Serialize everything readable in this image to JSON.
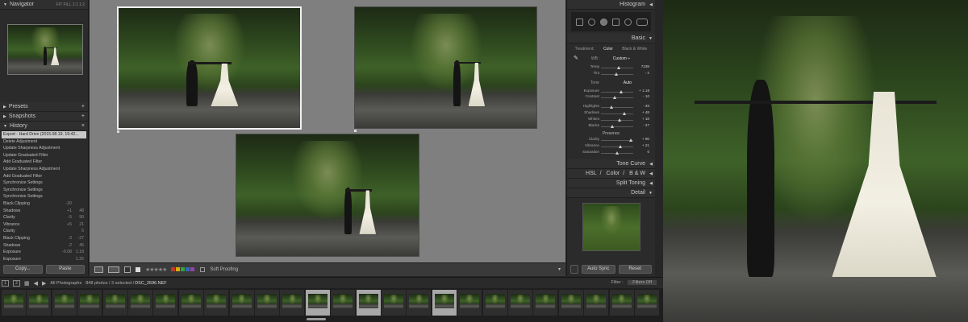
{
  "left_panel": {
    "navigator": {
      "title": "Navigator",
      "options": "FIT  FILL  1:1  1:2"
    },
    "presets": {
      "title": "Presets"
    },
    "snapshots": {
      "title": "Snapshots"
    },
    "history": {
      "title": "History",
      "items": [
        {
          "label": "Export - Hard Drive (2015.08.19. 19:42...",
          "a": "",
          "b": "",
          "selected": true
        },
        {
          "label": "Delete Adjustment",
          "a": "",
          "b": ""
        },
        {
          "label": "Update Sharpness Adjustment",
          "a": "",
          "b": ""
        },
        {
          "label": "Update Graduated Filter",
          "a": "",
          "b": ""
        },
        {
          "label": "Add Graduated Filter",
          "a": "",
          "b": ""
        },
        {
          "label": "Update Sharpness Adjustment",
          "a": "",
          "b": ""
        },
        {
          "label": "Add Graduated Filter",
          "a": "",
          "b": ""
        },
        {
          "label": "Synchronize Settings",
          "a": "",
          "b": ""
        },
        {
          "label": "Synchronize Settings",
          "a": "",
          "b": ""
        },
        {
          "label": "Synchronize Settings",
          "a": "",
          "b": ""
        },
        {
          "label": "Black Clipping",
          "a": "-20",
          "b": ""
        },
        {
          "label": "Shadows",
          "a": "+1",
          "b": "48"
        },
        {
          "label": "Clarity",
          "a": "-5",
          "b": "90"
        },
        {
          "label": "Vibrance",
          "a": "+5",
          "b": "21"
        },
        {
          "label": "Clarity",
          "a": "",
          "b": "5"
        },
        {
          "label": "Black Clipping",
          "a": "-3",
          "b": "-27"
        },
        {
          "label": "Shadows",
          "a": "-2",
          "b": "45"
        },
        {
          "label": "Exposure",
          "a": "-0.08",
          "b": "1.18"
        },
        {
          "label": "Exposure",
          "a": "",
          "b": "1.26"
        }
      ]
    },
    "copy_label": "Copy...",
    "paste_label": "Paste"
  },
  "toolbar": {
    "stars": "★★★★★",
    "soft_proofing": "Soft Proofing",
    "colors": [
      "#c0392b",
      "#d4b106",
      "#3a9e3a",
      "#3667b5",
      "#8e44ad"
    ]
  },
  "right_panel": {
    "histogram": "Histogram",
    "basic": "Basic",
    "treatment": {
      "photo": "Treatment:",
      "color": "Color",
      "bw": "Black & White"
    },
    "wb": {
      "label": "WB :",
      "value": "Custom ÷"
    },
    "wb_sliders": [
      {
        "label": "Temp",
        "value": "7238",
        "pos": 0.55
      },
      {
        "label": "Tint",
        "value": "- 2",
        "pos": 0.48
      }
    ],
    "tone": {
      "label": "Tone",
      "auto": "Auto"
    },
    "tone_sliders": [
      {
        "label": "Exposure",
        "value": "+ 1.18",
        "pos": 0.62
      },
      {
        "label": "Contrast",
        "value": "- 10",
        "pos": 0.42
      }
    ],
    "tone_sliders2": [
      {
        "label": "Highlights",
        "value": "- 40",
        "pos": 0.32
      },
      {
        "label": "Shadows",
        "value": "+ 48",
        "pos": 0.72
      },
      {
        "label": "Whites",
        "value": "+ 18",
        "pos": 0.58
      },
      {
        "label": "Blacks",
        "value": "- 27",
        "pos": 0.36
      }
    ],
    "presence": "Presence",
    "presence_sliders": [
      {
        "label": "Clarity",
        "value": "+ 90",
        "pos": 0.92
      },
      {
        "label": "Vibrance",
        "value": "+ 21",
        "pos": 0.6
      },
      {
        "label": "Saturation",
        "value": "0",
        "pos": 0.5
      }
    ],
    "tone_curve": "Tone Curve",
    "hsl": {
      "hsl": "HSL",
      "color": "Color",
      "bw": "B & W"
    },
    "split_toning": "Split Toning",
    "detail": "Detail",
    "auto_sync": "Auto Sync",
    "reset": "Reset"
  },
  "filmbar": {
    "page1": "1",
    "page2": "2",
    "source": "All Photographs",
    "info": "848 photos / 3 selected /",
    "file": "DSC_2696.NEF",
    "filter_label": "Filter :",
    "filter_value": "Filters Off"
  },
  "filmstrip": {
    "highlighted": [
      12,
      14,
      17
    ]
  }
}
